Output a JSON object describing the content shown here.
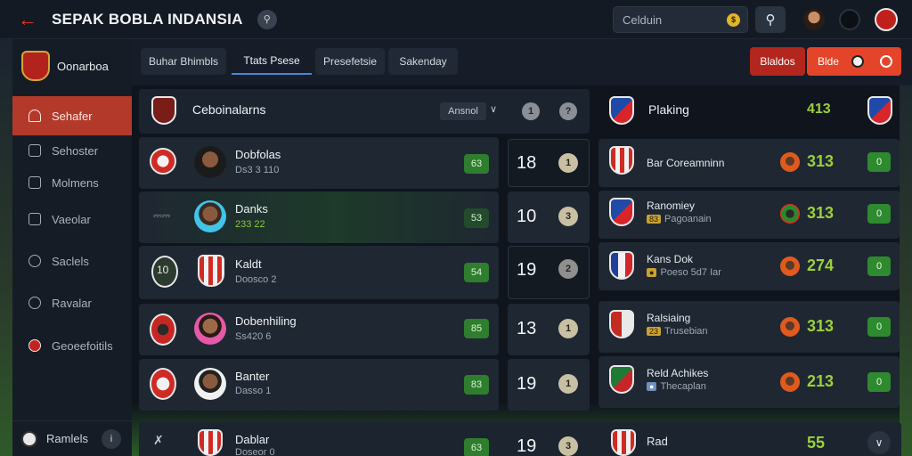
{
  "header": {
    "title": "SEPAK BOBLA INDANSIA",
    "search_value": "Celduin",
    "back_icon": "arrow-left-icon",
    "search_icon": "search-icon"
  },
  "sidebar": {
    "brand": "Oonarboa",
    "items": [
      {
        "label": "Sehafer",
        "icon": "home-icon",
        "active": true
      },
      {
        "label": "Sehoster",
        "icon": "calendar-icon"
      },
      {
        "label": "Molmens",
        "icon": "list-icon"
      },
      {
        "label": "Vaeolar",
        "icon": "trophy-icon"
      },
      {
        "label": "Saclels",
        "icon": "clock-icon"
      },
      {
        "label": "Ravalar",
        "icon": "shield-icon"
      },
      {
        "label": "Geoeefoitils",
        "icon": "club-badge-icon"
      }
    ],
    "footer": {
      "label": "Ramlels",
      "info": "i"
    }
  },
  "tabs": [
    {
      "label": "Buhar Bhimbls"
    },
    {
      "label": "Ttats Psese",
      "active": true
    },
    {
      "label": "Presefetsie"
    },
    {
      "label": "Sakenday"
    }
  ],
  "actions": {
    "primary": "Blaldos",
    "secondary": "Blde"
  },
  "left_panel": {
    "title": "Ceboinalarns",
    "sort_label": "Ansnol",
    "round_btn_1": "1",
    "round_btn_2": "?",
    "rows": [
      {
        "name": "Dobfolas",
        "sub": "Ds3 3 110",
        "badge": "63",
        "score": "18",
        "dot": "1"
      },
      {
        "name": "Danks",
        "sub": "233 22",
        "badge": "53",
        "score": "10",
        "dot": "3"
      },
      {
        "name": "Kaldt",
        "sub": "Doosco 2",
        "badge": "54",
        "score": "19",
        "dot": "2"
      },
      {
        "name": "Dobenhiling",
        "sub": "Ss420 6",
        "badge": "85",
        "score": "13",
        "dot": "1"
      },
      {
        "name": "Banter",
        "sub": "Dasso 1",
        "badge": "83",
        "score": "19",
        "dot": "1"
      },
      {
        "name": "Dablar",
        "sub": "Doseor 0",
        "badge": "63",
        "score": "19",
        "dot": "3"
      }
    ],
    "row3_crest_text": "10"
  },
  "right_panel": {
    "title": "Plaking",
    "score": "413",
    "rows": [
      {
        "name": "Bar Coreamninn",
        "sub": "",
        "score": "313",
        "badge": "0"
      },
      {
        "name": "Ranomiey",
        "tag": "83",
        "sub": "Pagoanain",
        "score": "313",
        "badge": "0"
      },
      {
        "name": "Kans Dok",
        "tag": "",
        "sub": "Poeso 5d7 Iar",
        "score": "274",
        "badge": "0"
      },
      {
        "name": "Ralsiaing",
        "tag": "23",
        "sub": "Trusebian",
        "score": "313",
        "badge": "0"
      },
      {
        "name": "Reld Achikes",
        "tag": "",
        "sub": "Thecaplan",
        "score": "213",
        "badge": "0"
      },
      {
        "name": "Rad",
        "sub": "",
        "score": "55",
        "badge": ""
      }
    ]
  }
}
